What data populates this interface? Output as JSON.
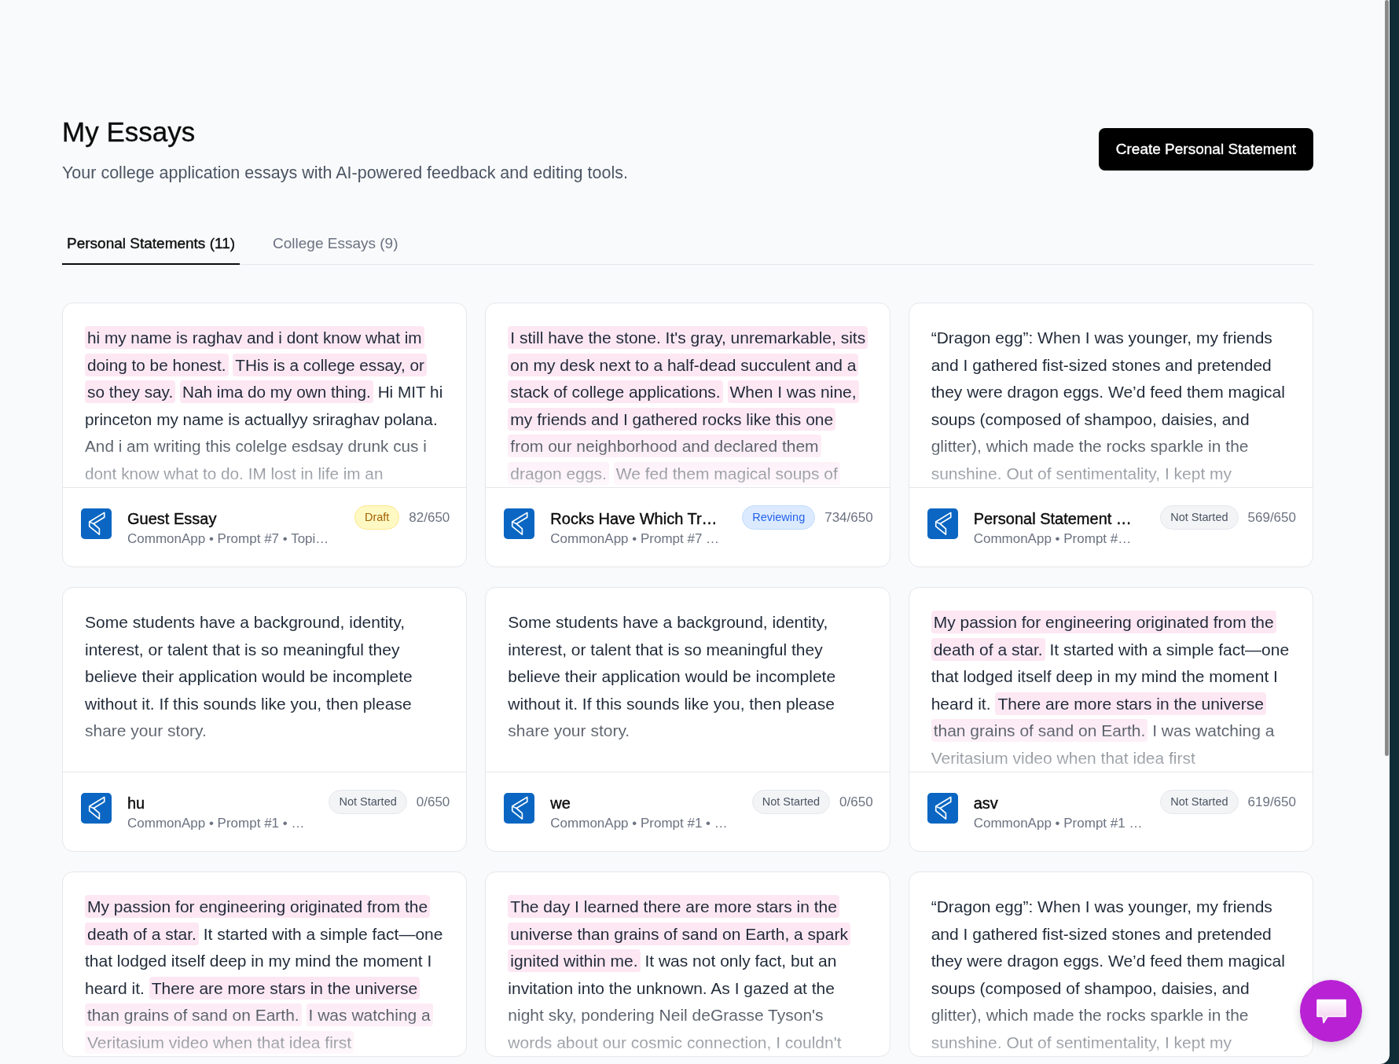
{
  "header": {
    "title": "My Essays",
    "subtitle": "Your college application essays with AI-powered feedback and editing tools.",
    "create_button": "Create Personal Statement"
  },
  "tabs": [
    {
      "label": "Personal Statements (11)",
      "selected": true
    },
    {
      "label": "College Essays (9)",
      "selected": false
    }
  ],
  "essays": [
    {
      "excerpt": [
        {
          "text": "hi my name is raghav and i dont know what im doing to be honest.",
          "highlighted": true
        },
        {
          "text": "THis is a college essay, or so they say.",
          "highlighted": true
        },
        {
          "text": "Nah ima do my own thing.",
          "highlighted": true
        },
        {
          "text": "Hi MIT hi princeton my name is actuallyy sriraghav polana. And i am writing this colelge esdsay drunk cus i dont know what to do. IM lost in life im an",
          "highlighted": false
        }
      ],
      "footer": {
        "title": "Guest Essay",
        "subtitle": "CommonApp • Prompt #7 • Topi…",
        "status": {
          "label": "Draft",
          "kind": "draft"
        },
        "word_count": "82/650"
      }
    },
    {
      "excerpt": [
        {
          "text": "I still have the stone. It's gray, unremarkable, sits on my desk next to a half-dead succulent and a stack of college applications.",
          "highlighted": true
        },
        {
          "text": "When I was nine, my friends and I gathered rocks like this one from our neighborhood and declared them dragon eggs.",
          "highlighted": true
        },
        {
          "text": "We fed them magical soups of",
          "highlighted": true
        }
      ],
      "footer": {
        "title": "Rocks Have Which Tr…",
        "subtitle": "CommonApp • Prompt #7 …",
        "status": {
          "label": "Reviewing",
          "kind": "reviewing"
        },
        "word_count": "734/650"
      }
    },
    {
      "excerpt": [
        {
          "text": "“Dragon egg”: When I was younger, my friends and I gathered fist-sized stones and pretended they were dragon eggs. We’d feed them magical soups (composed of shampoo, daisies, and glitter), which made the rocks sparkle in the sunshine. Out of sentimentality, I kept my",
          "highlighted": false
        }
      ],
      "footer": {
        "title": "Personal Statement …",
        "subtitle": "CommonApp • Prompt #…",
        "status": {
          "label": "Not Started",
          "kind": "not_started"
        },
        "word_count": "569/650"
      }
    },
    {
      "excerpt": [
        {
          "text": "Some students have a background, identity, interest, or talent that is so meaningful they believe their application would be incomplete without it. If this sounds like you, then please share your story.",
          "highlighted": false
        }
      ],
      "footer": {
        "title": "hu",
        "subtitle": "CommonApp • Prompt #1 • …",
        "status": {
          "label": "Not Started",
          "kind": "not_started"
        },
        "word_count": "0/650"
      }
    },
    {
      "excerpt": [
        {
          "text": "Some students have a background, identity, interest, or talent that is so meaningful they believe their application would be incomplete without it. If this sounds like you, then please share your story.",
          "highlighted": false
        }
      ],
      "footer": {
        "title": "we",
        "subtitle": "CommonApp • Prompt #1 • …",
        "status": {
          "label": "Not Started",
          "kind": "not_started"
        },
        "word_count": "0/650"
      }
    },
    {
      "excerpt": [
        {
          "text": "My passion for engineering originated from the death of a star.",
          "highlighted": true
        },
        {
          "text": "It started with a simple fact—one that lodged itself deep in my mind the moment I heard it.",
          "highlighted": false
        },
        {
          "text": "There are more stars in the universe than grains of sand on Earth.",
          "highlighted": true
        },
        {
          "text": "I was watching a Veritasium video when that idea first",
          "highlighted": false
        }
      ],
      "footer": {
        "title": "asv",
        "subtitle": "CommonApp • Prompt #1 …",
        "status": {
          "label": "Not Started",
          "kind": "not_started"
        },
        "word_count": "619/650"
      }
    },
    {
      "excerpt": [
        {
          "text": "My passion for engineering originated from the death of a star.",
          "highlighted": true
        },
        {
          "text": "It started with a simple fact—one that lodged itself deep in my mind the moment I heard it.",
          "highlighted": false
        },
        {
          "text": "There are more stars in the universe than grains of sand on Earth.",
          "highlighted": true
        },
        {
          "text": "I was watching a Veritasium video when that idea first",
          "highlighted": true
        }
      ]
    },
    {
      "excerpt": [
        {
          "text": "The day I learned there are more stars in the universe than grains of sand on Earth, a spark ignited within me.",
          "highlighted": true
        },
        {
          "text": "It was not only fact, but an invitation into the unknown. As I gazed at the night sky, pondering Neil deGrasse Tyson's words about our cosmic connection, I couldn't",
          "highlighted": false
        }
      ]
    },
    {
      "excerpt": [
        {
          "text": "“Dragon egg”: When I was younger, my friends and I gathered fist-sized stones and pretended they were dragon eggs. We’d feed them magical soups (composed of shampoo, daisies, and glitter), which made the rocks sparkle in the sunshine. Out of sentimentality, I kept my",
          "highlighted": false
        }
      ]
    }
  ]
}
